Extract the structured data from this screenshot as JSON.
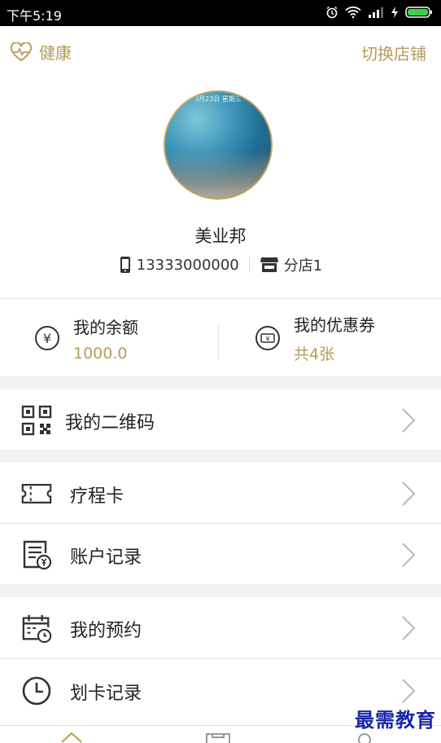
{
  "status_bar": {
    "time": "下午5:19"
  },
  "header": {
    "health_label": "健康",
    "switch_store_label": "切换店铺"
  },
  "profile": {
    "avatar_screen_text": "3月23日 星期三",
    "name": "美业邦",
    "phone": "13333000000",
    "store": "分店1"
  },
  "wallet": {
    "balance_title": "我的余额",
    "balance_value": "1000.0",
    "balance_symbol": "¥",
    "coupon_title": "我的优惠券",
    "coupon_value": "共4张",
    "coupon_symbol": "¥"
  },
  "menu": {
    "qrcode": "我的二维码",
    "treatment_card": "疗程卡",
    "account_records": "账户记录",
    "appointments": "我的预约",
    "card_records": "划卡记录"
  },
  "watermark": "最需教育",
  "colors": {
    "accent": "#b99a5a",
    "divider": "#e6e6e6",
    "section_gap": "#f2f2f2"
  }
}
